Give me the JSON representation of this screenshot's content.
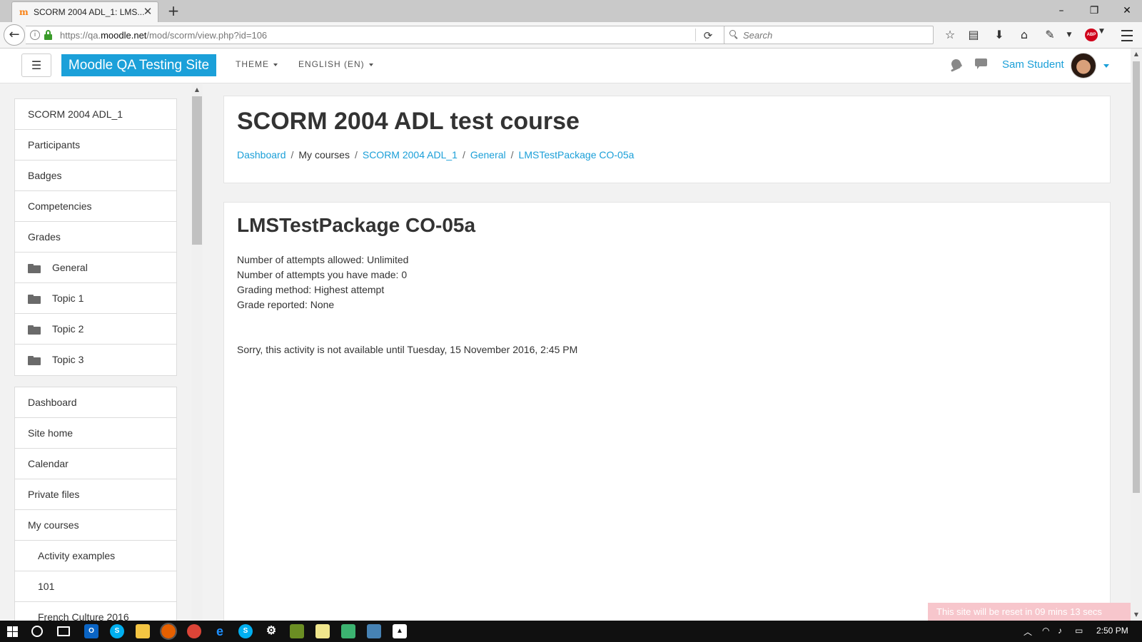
{
  "browser": {
    "tab_title": "SCORM 2004 ADL_1: LMS...",
    "tab_favicon": "moodle-m-icon",
    "url_prefix": "https://qa.",
    "url_domain": "moodle.net",
    "url_path": "/mod/scorm/view.php?id=106",
    "search_placeholder": "Search",
    "abp_label": "ABP"
  },
  "header": {
    "site_name": "Moodle QA Testing Site",
    "theme_label": "THEME",
    "language_label": "ENGLISH (EN)",
    "user_name": "Sam Student",
    "accent_color": "#1ba0d9"
  },
  "drawer": {
    "course_items": [
      {
        "label": "SCORM 2004 ADL_1"
      },
      {
        "label": "Participants"
      },
      {
        "label": "Badges"
      },
      {
        "label": "Competencies"
      },
      {
        "label": "Grades"
      },
      {
        "label": "General"
      },
      {
        "label": "Topic 1"
      },
      {
        "label": "Topic 2"
      },
      {
        "label": "Topic 3"
      }
    ],
    "site_items": [
      {
        "label": "Dashboard"
      },
      {
        "label": "Site home"
      },
      {
        "label": "Calendar"
      },
      {
        "label": "Private files"
      },
      {
        "label": "My courses"
      },
      {
        "label": "Activity examples"
      },
      {
        "label": "101"
      },
      {
        "label": "French Culture 2016"
      }
    ]
  },
  "page": {
    "course_title": "SCORM 2004 ADL test course",
    "breadcrumb": [
      "Dashboard",
      "My courses",
      "SCORM 2004 ADL_1",
      "General",
      "LMSTestPackage CO-05a"
    ],
    "activity_title": "LMSTestPackage CO-05a",
    "info": [
      "Number of attempts allowed: Unlimited",
      "Number of attempts you have made: 0",
      "Grading method: Highest attempt",
      "Grade reported: None"
    ],
    "availability_message": "Sorry, this activity is not available until Tuesday, 15 November 2016, 2:45 PM",
    "reset_notice": "This site will be reset in 09 mins 13 secs"
  },
  "taskbar": {
    "clock": "2:50 PM"
  }
}
